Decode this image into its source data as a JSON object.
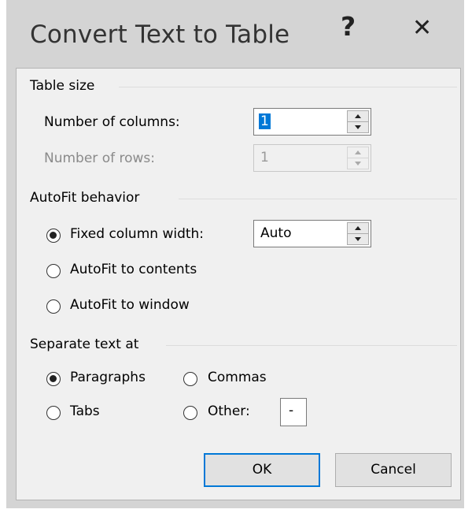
{
  "dialog": {
    "title": "Convert Text to Table",
    "help": "?",
    "close": "✕"
  },
  "table_size": {
    "header": "Table size",
    "columns_label": "Number of columns:",
    "columns_value": "1",
    "rows_label": "Number of rows:",
    "rows_value": "1"
  },
  "autofit": {
    "header": "AutoFit behavior",
    "fixed_label": "Fixed column width:",
    "fixed_value": "Auto",
    "contents_label": "AutoFit to contents",
    "window_label": "AutoFit to window",
    "selected": "fixed"
  },
  "separate": {
    "header": "Separate text at",
    "paragraphs_label": "Paragraphs",
    "commas_label": "Commas",
    "tabs_label": "Tabs",
    "other_label": "Other:",
    "other_value": "-",
    "selected": "paragraphs"
  },
  "buttons": {
    "ok": "OK",
    "cancel": "Cancel"
  },
  "colors": {
    "accent": "#0078d7",
    "chrome": "#d4d4d4",
    "panel": "#f0f0f0"
  }
}
